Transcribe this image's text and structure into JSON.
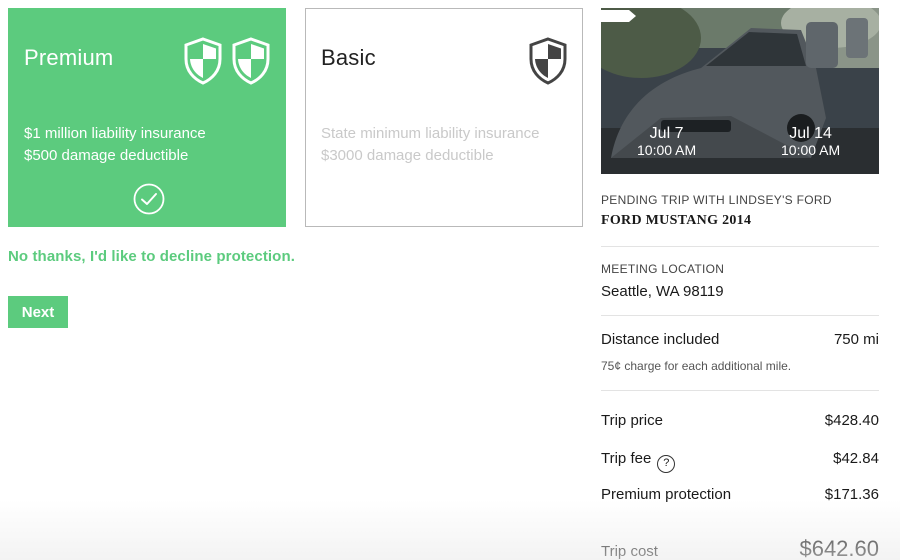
{
  "plans": {
    "premium": {
      "title": "Premium",
      "line1": "$1 million liability insurance",
      "line2": "$500 damage deductible",
      "selected": true,
      "icon": "shield-icon",
      "check_icon": "check-circle-icon"
    },
    "basic": {
      "title": "Basic",
      "line1": "State minimum liability insurance",
      "line2": "$3000 damage deductible",
      "selected": false,
      "icon": "shield-icon"
    }
  },
  "decline_link": "No thanks, I'd like to decline protection.",
  "next_button": "Next",
  "trip": {
    "dates": {
      "from_date": "Jul 7",
      "from_time": "10:00 AM",
      "to_date": "Jul 14",
      "to_time": "10:00 AM"
    },
    "status_label": "PENDING TRIP WITH LINDSEY'S FORD",
    "car_name": "FORD MUSTANG 2014",
    "meeting_label": "MEETING LOCATION",
    "meeting_value": "Seattle, WA 98119",
    "distance_label": "Distance included",
    "distance_value": "750 mi",
    "distance_note": "75¢ charge for each additional mile.",
    "trip_price_label": "Trip price",
    "trip_price_value": "$428.40",
    "trip_fee_label": "Trip fee",
    "trip_fee_help": "?",
    "trip_fee_value": "$42.84",
    "protection_label": "Premium protection",
    "protection_value": "$171.36",
    "total_label": "Trip cost",
    "total_value": "$642.60"
  },
  "colors": {
    "accent": "#5ccb7e",
    "muted_text": "#c9c9c9"
  }
}
